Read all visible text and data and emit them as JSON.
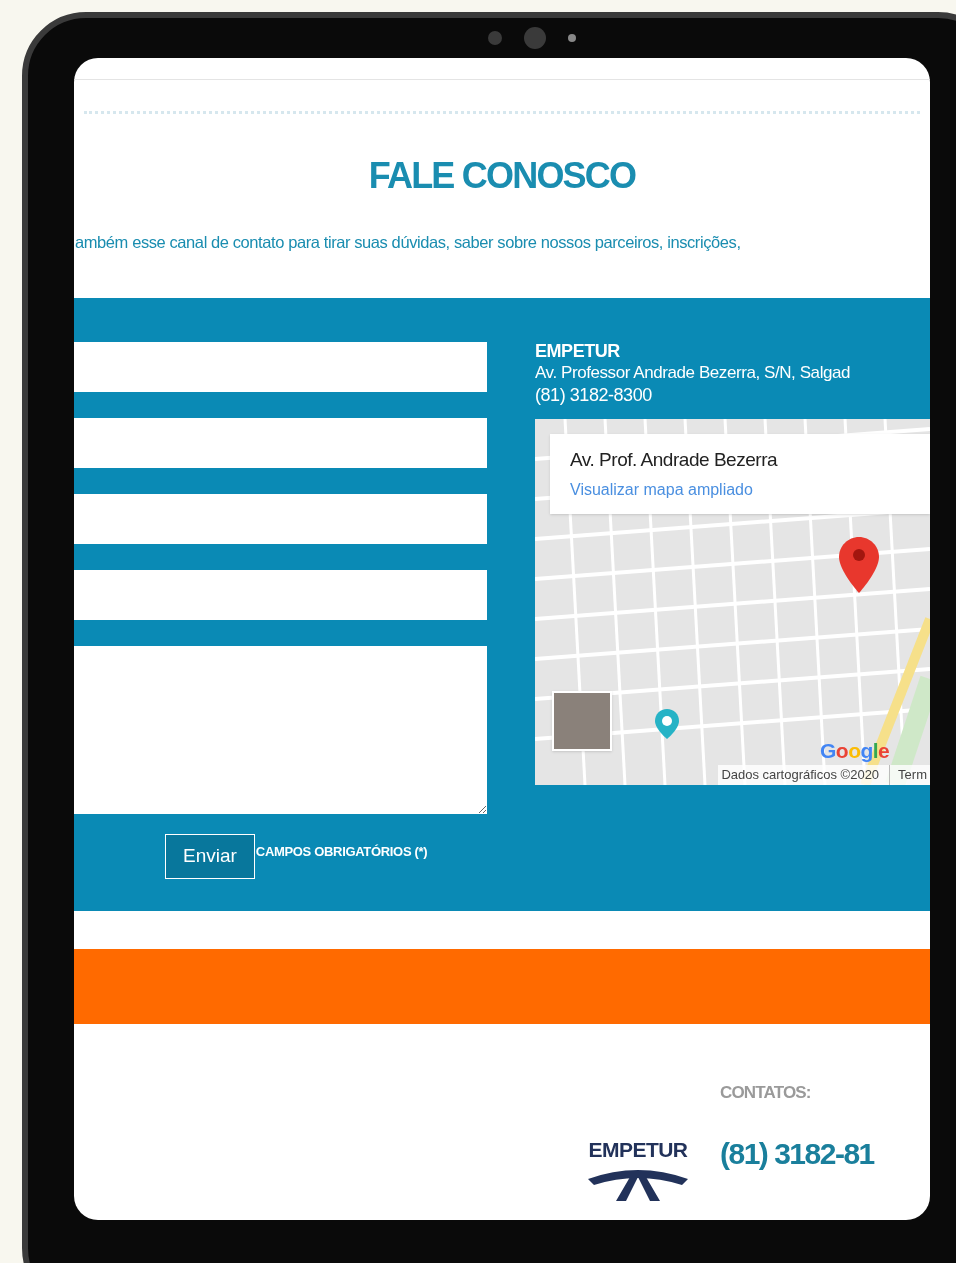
{
  "section": {
    "title": "FALE CONOSCO",
    "intro": "ambém esse canal de contato para tirar suas dúvidas, saber sobre nossos parceiros, inscrições,"
  },
  "form": {
    "fields": [
      {
        "kind": "input"
      },
      {
        "kind": "input"
      },
      {
        "kind": "input"
      },
      {
        "kind": "input"
      },
      {
        "kind": "textarea"
      }
    ],
    "submit": "Enviar",
    "required_note": "CAMPOS OBRIGATÓRIOS (*)"
  },
  "contact": {
    "name": "EMPETUR",
    "address": "Av. Professor Andrade Bezerra, S/N, Salgad",
    "phone": "(81) 3182-8300"
  },
  "map": {
    "place_title": "Av. Prof. Andrade Bezerra",
    "link": "Visualizar mapa ampliado",
    "logo": "Google",
    "attribution": "Dados cartográficos ©2020",
    "terms": "Term"
  },
  "footer": {
    "contacts_label": "CONTATOS:",
    "logo_text": "EMPETUR",
    "phone": "(81) 3182-81"
  }
}
